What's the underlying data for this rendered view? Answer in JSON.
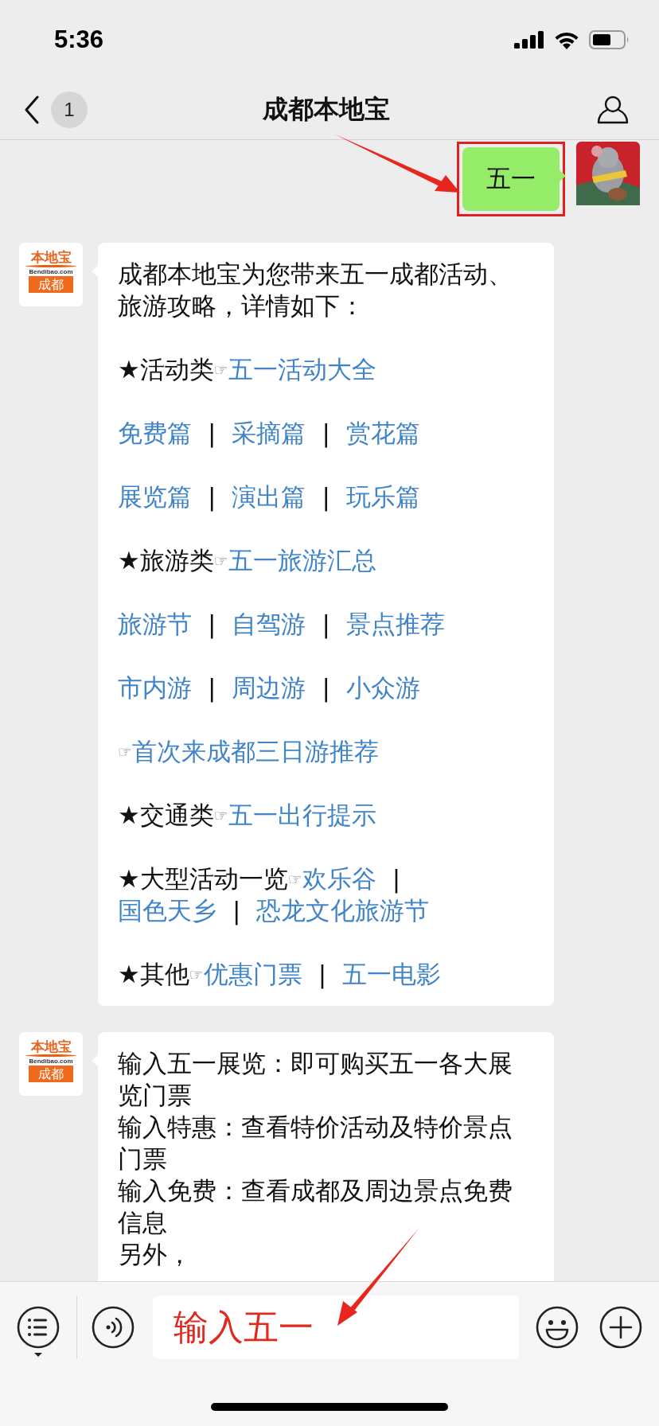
{
  "status_bar": {
    "time": "5:36"
  },
  "nav": {
    "back_badge": "1",
    "title": "成都本地宝"
  },
  "messages": [
    {
      "kind": "sent",
      "highlighted": true,
      "text": "五一"
    },
    {
      "kind": "received",
      "avatar": {
        "kind": "logo",
        "brand": "本地宝",
        "domain": "Bendibao.com",
        "city": "成都"
      },
      "paragraphs": [
        [
          {
            "kind": "plain",
            "text": "成都本地宝为您带来五一成都活动、旅游攻略，详情如下："
          }
        ],
        [
          {
            "kind": "plain",
            "text": "★活动类"
          },
          {
            "kind": "hand",
            "text": "☞"
          },
          {
            "kind": "link",
            "text": "五一活动大全"
          }
        ],
        [
          {
            "kind": "link",
            "text": "免费篇"
          },
          {
            "kind": "sep",
            "text": "|"
          },
          {
            "kind": "link",
            "text": "采摘篇"
          },
          {
            "kind": "sep",
            "text": "|"
          },
          {
            "kind": "link",
            "text": "赏花篇"
          }
        ],
        [
          {
            "kind": "link",
            "text": "展览篇"
          },
          {
            "kind": "sep",
            "text": "|"
          },
          {
            "kind": "link",
            "text": "演出篇"
          },
          {
            "kind": "sep",
            "text": "|"
          },
          {
            "kind": "link",
            "text": "玩乐篇"
          }
        ],
        [
          {
            "kind": "plain",
            "text": "★旅游类"
          },
          {
            "kind": "hand",
            "text": "☞"
          },
          {
            "kind": "link",
            "text": "五一旅游汇总"
          }
        ],
        [
          {
            "kind": "link",
            "text": "旅游节"
          },
          {
            "kind": "sep",
            "text": "|"
          },
          {
            "kind": "link",
            "text": "自驾游"
          },
          {
            "kind": "sep",
            "text": "|"
          },
          {
            "kind": "link",
            "text": "景点推荐"
          }
        ],
        [
          {
            "kind": "link",
            "text": "市内游"
          },
          {
            "kind": "sep",
            "text": "|"
          },
          {
            "kind": "link",
            "text": "周边游"
          },
          {
            "kind": "sep",
            "text": "|"
          },
          {
            "kind": "link",
            "text": "小众游"
          }
        ],
        [
          {
            "kind": "hand",
            "text": "☞"
          },
          {
            "kind": "link",
            "text": "首次来成都三日游推荐"
          }
        ],
        [
          {
            "kind": "plain",
            "text": "★交通类"
          },
          {
            "kind": "hand",
            "text": "☞"
          },
          {
            "kind": "link",
            "text": "五一出行提示"
          }
        ],
        [
          {
            "kind": "plain",
            "text": "★大型活动一览"
          },
          {
            "kind": "hand",
            "text": "☞"
          },
          {
            "kind": "link",
            "text": "欢乐谷"
          },
          {
            "kind": "sep",
            "text": "|"
          },
          {
            "kind": "link",
            "text": "国色天乡"
          },
          {
            "kind": "sep",
            "text": "|"
          },
          {
            "kind": "link",
            "text": "恐龙文化旅游节"
          }
        ],
        [
          {
            "kind": "plain",
            "text": "★其他"
          },
          {
            "kind": "hand",
            "text": "☞"
          },
          {
            "kind": "link",
            "text": "优惠门票"
          },
          {
            "kind": "sep",
            "text": "|"
          },
          {
            "kind": "link",
            "text": "五一电影"
          }
        ]
      ],
      "spaced": true
    },
    {
      "kind": "received",
      "avatar": {
        "kind": "logo",
        "brand": "本地宝",
        "domain": "Bendibao.com",
        "city": "成都"
      },
      "paragraphs": [
        [
          {
            "kind": "plain",
            "text": "输入五一展览：即可购买五一各大展览门票"
          }
        ],
        [
          {
            "kind": "plain",
            "text": "输入特惠：查看特价活动及特价景点门票"
          }
        ],
        [
          {
            "kind": "plain",
            "text": "输入免费：查看成都及周边景点免费信息"
          }
        ],
        [
          {
            "kind": "plain",
            "text": "另外，"
          }
        ]
      ],
      "spaced": false
    }
  ],
  "input": {
    "value": "输入五一"
  }
}
